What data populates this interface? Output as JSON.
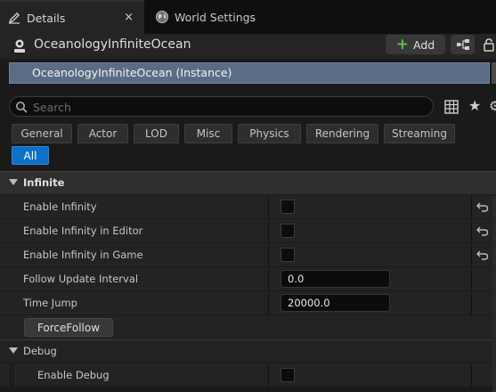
{
  "tabs": [
    {
      "label": "Details",
      "icon": "pencil-icon",
      "active": true,
      "close": "×"
    },
    {
      "label": "World Settings",
      "icon": "globe-icon",
      "active": false
    }
  ],
  "header": {
    "actor_name": "OceanologyInfiniteOcean",
    "add_label": "Add",
    "actor_icon": "actor-icon"
  },
  "tree": {
    "selected_item": "OceanologyInfiniteOcean (Instance)"
  },
  "search": {
    "placeholder": "Search"
  },
  "filters": [
    "General",
    "Actor",
    "LOD",
    "Misc",
    "Physics",
    "Rendering",
    "Streaming"
  ],
  "filter_all": "All",
  "categories": {
    "infinite": {
      "label": "Infinite",
      "properties": [
        {
          "label": "Enable Infinity",
          "type": "checkbox",
          "checked": false,
          "reset": true
        },
        {
          "label": "Enable Infinity in Editor",
          "type": "checkbox",
          "checked": false,
          "reset": true
        },
        {
          "label": "Enable Infinity in Game",
          "type": "checkbox",
          "checked": false,
          "reset": true
        },
        {
          "label": "Follow Update Interval",
          "type": "number",
          "value": "0.0"
        },
        {
          "label": "Time Jump",
          "type": "number",
          "value": "20000.0"
        }
      ],
      "action_button": "ForceFollow"
    },
    "debug": {
      "label": "Debug",
      "properties": [
        {
          "label": "Enable Debug",
          "type": "checkbox",
          "checked": false
        }
      ]
    }
  },
  "colors": {
    "accent_blue": "#0e70c8",
    "selection": "#5b6d84",
    "add_plus_green": "#5fc04a"
  }
}
